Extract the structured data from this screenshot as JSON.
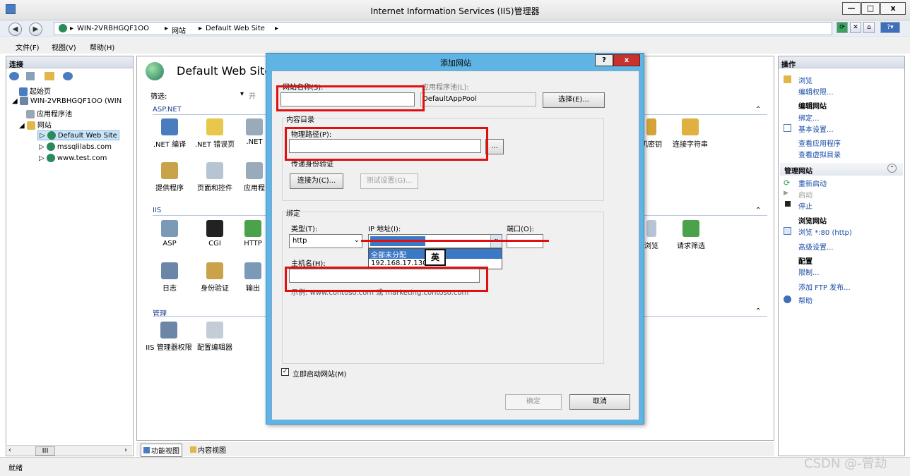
{
  "window": {
    "title": "Internet Information Services (IIS)管理器",
    "minimize": "—",
    "maximize": "□",
    "close": "x"
  },
  "address": {
    "segments": [
      "WIN-2VRBHGQF1OO",
      "网站",
      "Default Web Site"
    ]
  },
  "menu": {
    "file": "文件(F)",
    "view": "视图(V)",
    "help": "帮助(H)"
  },
  "connections": {
    "header": "连接",
    "tree": [
      {
        "label": "起始页"
      },
      {
        "label": "WIN-2VRBHGQF1OO (WIN"
      },
      {
        "label": "应用程序池"
      },
      {
        "label": "网站"
      },
      {
        "label": "Default Web Site"
      },
      {
        "label": "mssqlilabs.com"
      },
      {
        "label": "www.test.com"
      }
    ],
    "scroll_label": "III"
  },
  "main": {
    "title": "Default Web Site",
    "filter_label": "筛选:",
    "filter_go": "开",
    "groups": {
      "aspnet": "ASP.NET",
      "iis": "IIS",
      "mgmt": "管理"
    },
    "aspnet_features": [
      ".NET 编译",
      ".NET 错误页",
      ".NET",
      "提供程序",
      "页面和控件",
      "应用程",
      "连接字符串",
      "机密钥"
    ],
    "iis_features": [
      "ASP",
      "CGI",
      "HTTP",
      "日志",
      "身份验证",
      "输出",
      "浏览",
      "请求筛选"
    ],
    "mgmt_features": [
      "IIS 管理器权限",
      "配置编辑器"
    ],
    "view_tabs": {
      "features": "功能视图",
      "content": "内容视图"
    }
  },
  "actions": {
    "header": "操作",
    "items": {
      "browse": "浏览",
      "edit_perms": "编辑权限...",
      "edit_site_head": "编辑网站",
      "bindings": "绑定...",
      "basic_settings": "基本设置...",
      "view_apps": "查看应用程序",
      "view_vdirs": "查看虚拟目录",
      "manage_site_head": "管理网站",
      "restart": "重新启动",
      "start": "启动",
      "stop": "停止",
      "browse_site_head": "浏览网站",
      "browse_80": "浏览 *:80 (http)",
      "advanced": "高级设置...",
      "config_head": "配置",
      "limits": "限制...",
      "add_ftp": "添加 FTP 发布...",
      "help": "帮助"
    }
  },
  "dialog": {
    "title": "添加网站",
    "help_btn": "?",
    "close_btn": "x",
    "site_name_label": "网站名称(S):",
    "site_name_value": "",
    "app_pool_label": "应用程序池(L):",
    "app_pool_value": "DefaultAppPool",
    "select_btn": "选择(E)...",
    "content_dir_group": "内容目录",
    "physical_path_label": "物理路径(P):",
    "physical_path_value": "",
    "browse_btn": "...",
    "passthrough_label": "传递身份验证",
    "connect_as_btn": "连接为(C)...",
    "test_settings_btn": "测试设置(G)...",
    "binding_group": "绑定",
    "type_label": "类型(T):",
    "type_value": "http",
    "ip_label": "IP 地址(I):",
    "ip_options": [
      "全部未分配",
      "192.168.17.130"
    ],
    "port_label": "端口(O):",
    "ime_badge": "英",
    "host_label": "主机名(H):",
    "host_value": "",
    "example_text": "示例: www.contoso.com 或 marketing.contoso.com",
    "start_now_label": "立即启动网站(M)",
    "ok_btn": "确定",
    "cancel_btn": "取消"
  },
  "status": {
    "text": "就绪",
    "watermark": "CSDN @-曾劫"
  }
}
